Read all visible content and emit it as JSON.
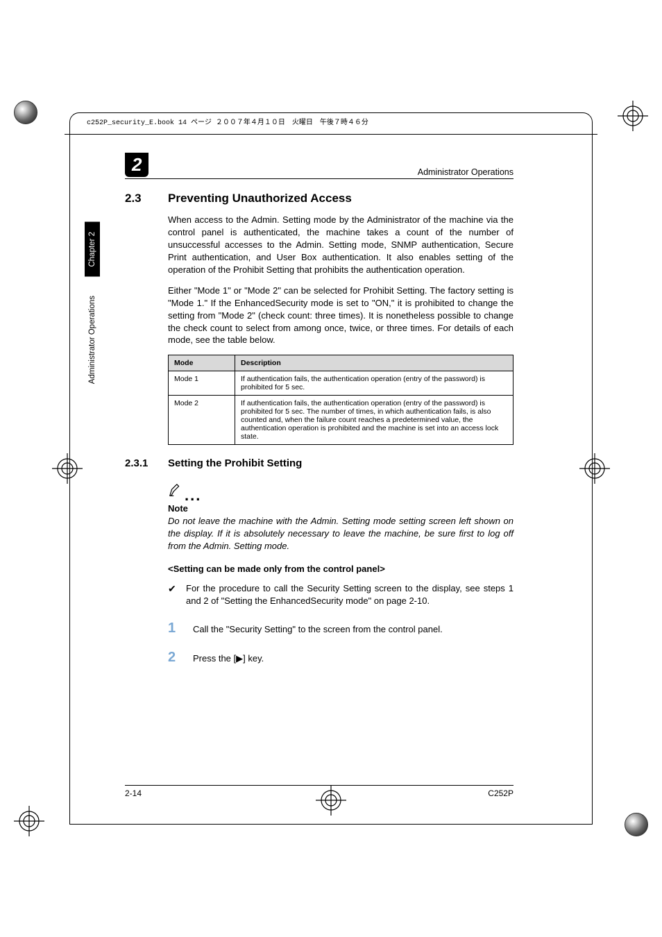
{
  "book_header": "c252P_security_E.book  14 ページ  ２００７年４月１０日　火曜日　午後７時４６分",
  "running_title": "Administrator Operations",
  "chapter_badge": "2",
  "side_tab_black": "Chapter 2",
  "side_tab_white": "Administrator Operations",
  "section": {
    "num": "2.3",
    "title": "Preventing Unauthorized Access"
  },
  "para1": "When access to the Admin. Setting mode by the Administrator of the machine via the control panel is authenticated, the machine takes a count of the number of unsuccessful accesses to the Admin. Setting mode, SNMP authentication, Secure Print authentication, and User Box authentication. It also enables setting of the operation of the Prohibit Setting that prohibits the authentication operation.",
  "para2": "Either \"Mode 1\" or \"Mode 2\" can be selected for Prohibit Setting. The factory setting is \"Mode 1.\" If the EnhancedSecurity mode is set to \"ON,\" it is prohibited to change the setting from \"Mode 2\" (check count: three times). It is nonetheless possible to change the check count to select from among once, twice, or three times. For details of each mode, see the table below.",
  "table": {
    "headers": [
      "Mode",
      "Description"
    ],
    "rows": [
      {
        "mode": "Mode 1",
        "desc": "If authentication fails, the authentication operation (entry of the password) is prohibited for 5 sec."
      },
      {
        "mode": "Mode 2",
        "desc": "If authentication fails, the authentication operation (entry of the password) is prohibited for 5 sec. The number of times, in which authentication fails, is also counted and, when the failure count reaches a predetermined value, the authentication operation is prohibited and the machine is set into an access lock state."
      }
    ]
  },
  "subsection": {
    "num": "2.3.1",
    "title": "Setting the Prohibit Setting"
  },
  "note": {
    "label": "Note",
    "body": "Do not leave the machine with the Admin. Setting mode setting screen left shown on the display. If it is absolutely necessary to leave the machine, be sure first to log off from the Admin. Setting mode."
  },
  "bold_sub": "<Setting can be made only from the control panel>",
  "check_item": "For the procedure to call the Security Setting screen to the display, see steps 1 and 2 of \"Setting the EnhancedSecurity mode\" on page 2-10.",
  "steps": [
    {
      "n": "1",
      "text": "Call the \"Security Setting\" to the screen from the control panel."
    },
    {
      "n": "2",
      "text": "Press the [▶] key."
    }
  ],
  "footer": {
    "left": "2-14",
    "right": "C252P"
  }
}
